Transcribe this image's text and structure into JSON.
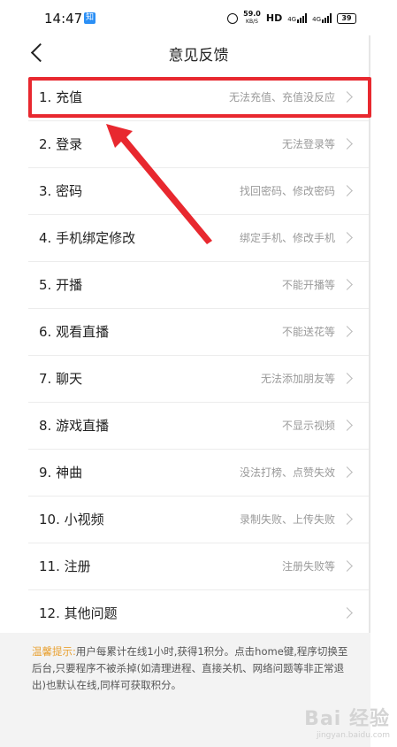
{
  "status_bar": {
    "time": "14:47",
    "app_badge": "知",
    "net_speed_value": "59.0",
    "net_speed_unit": "KB/S",
    "hd_label": "HD",
    "signal1_label": "4G",
    "signal2_label": "4G",
    "battery": "39"
  },
  "nav": {
    "title": "意见反馈"
  },
  "items": [
    {
      "label": "1. 充值",
      "hint": "无法充值、充值没反应"
    },
    {
      "label": "2. 登录",
      "hint": "无法登录等"
    },
    {
      "label": "3. 密码",
      "hint": "找回密码、修改密码"
    },
    {
      "label": "4. 手机绑定修改",
      "hint": "绑定手机、修改手机"
    },
    {
      "label": "5. 开播",
      "hint": "不能开播等"
    },
    {
      "label": "6. 观看直播",
      "hint": "不能送花等"
    },
    {
      "label": "7. 聊天",
      "hint": "无法添加朋友等"
    },
    {
      "label": "8. 游戏直播",
      "hint": "不显示视频"
    },
    {
      "label": "9. 神曲",
      "hint": "没法打榜、点赞失效"
    },
    {
      "label": "10. 小视频",
      "hint": "录制失败、上传失败"
    },
    {
      "label": "11. 注册",
      "hint": "注册失败等"
    },
    {
      "label": "12. 其他问题",
      "hint": ""
    }
  ],
  "tip": {
    "label": "温馨提示:",
    "text": "用户每累计在线1小时,获得1积分。点击home键,程序切换至后台,只要程序不被杀掉(如清理进程、直接关机、网络问题等非正常退出)也默认在线,同样可获取积分。"
  },
  "watermark": {
    "brand": "Bai 经验",
    "url": "jingyan.baidu.com"
  },
  "colors": {
    "highlight": "#e8282f",
    "tip_label": "#e8a030",
    "hint_text": "#9a9a9a"
  }
}
